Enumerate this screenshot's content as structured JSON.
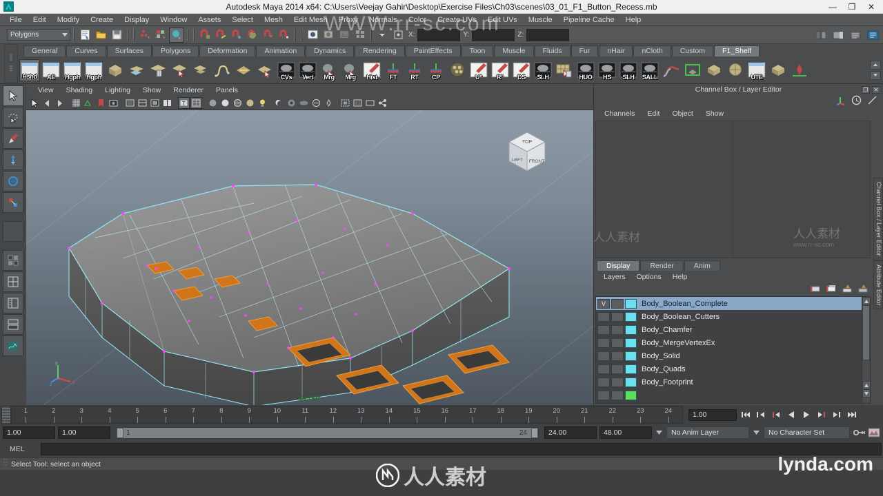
{
  "window": {
    "title": "Autodesk Maya 2014 x64: C:\\Users\\Veejay Gahir\\Desktop\\Exercise Files\\Ch03\\scenes\\03_01_F1_Button_Recess.mb",
    "minimize": "—",
    "maximize": "❐",
    "close": "✕"
  },
  "menubar": {
    "items": [
      "File",
      "Edit",
      "Modify",
      "Create",
      "Display",
      "Window",
      "Assets",
      "Select",
      "Mesh",
      "Edit Mesh",
      "Proxy",
      "Normals",
      "Color",
      "Create UVs",
      "Edit UVs",
      "Muscle",
      "Pipeline Cache",
      "Help"
    ]
  },
  "statusline": {
    "mode_selected": "Polygons",
    "x_label": "X:",
    "y_label": "Y:",
    "z_label": "Z:",
    "x_value": "",
    "y_value": "",
    "z_value": ""
  },
  "shelf": {
    "tabs": [
      "General",
      "Curves",
      "Surfaces",
      "Polygons",
      "Deformation",
      "Animation",
      "Dynamics",
      "Rendering",
      "PaintEffects",
      "Toon",
      "Muscle",
      "Fluids",
      "Fur",
      "nHair",
      "nCloth",
      "Custom",
      "F1_Shelf"
    ],
    "active_tab": "F1_Shelf",
    "buttons": [
      {
        "label": "Hshd",
        "type": "window",
        "selected": true
      },
      {
        "label": "AE",
        "type": "window",
        "selected": false
      },
      {
        "label": "Hgph",
        "type": "window",
        "selected": false
      },
      {
        "label": "Hgph",
        "type": "window",
        "selected": false
      },
      {
        "label": "",
        "type": "mesh-cube",
        "selected": false
      },
      {
        "label": "",
        "type": "mesh-plane",
        "selected": false
      },
      {
        "label": "",
        "type": "mesh-delete",
        "selected": false
      },
      {
        "label": "",
        "type": "mesh-select",
        "selected": false
      },
      {
        "label": "",
        "type": "mesh-combine",
        "selected": false
      },
      {
        "label": "",
        "type": "curve-s",
        "selected": false
      },
      {
        "label": "",
        "type": "bevel",
        "selected": false
      },
      {
        "label": "",
        "type": "extrude",
        "selected": false
      },
      {
        "label": "CVs",
        "type": "display",
        "selected": false
      },
      {
        "label": "Vert",
        "type": "display",
        "selected": false
      },
      {
        "label": "Mrg",
        "type": "merge",
        "selected": false
      },
      {
        "label": "Mrg",
        "type": "merge",
        "selected": false
      },
      {
        "label": "Hist",
        "type": "edit",
        "selected": false
      },
      {
        "label": "FT",
        "type": "xform",
        "selected": false
      },
      {
        "label": "RT",
        "type": "xform",
        "selected": false
      },
      {
        "label": "CP",
        "type": "xform",
        "selected": false
      },
      {
        "label": "",
        "type": "sphere-wire",
        "selected": false
      },
      {
        "label": "U\"",
        "type": "edit",
        "selected": false
      },
      {
        "label": "R\"",
        "type": "edit",
        "selected": false
      },
      {
        "label": "DS",
        "type": "edit",
        "selected": false
      },
      {
        "label": "SLH",
        "type": "display",
        "selected": false
      },
      {
        "label": "",
        "type": "grid-delete",
        "selected": false
      },
      {
        "label": "HUO",
        "type": "display",
        "selected": false
      },
      {
        "label": "HS",
        "type": "display",
        "selected": false
      },
      {
        "label": "SLH",
        "type": "display",
        "selected": false
      },
      {
        "label": "SALL",
        "type": "display",
        "selected": false
      },
      {
        "label": "",
        "type": "curve-red",
        "selected": false
      },
      {
        "label": "",
        "type": "plane-green",
        "selected": false
      },
      {
        "label": "",
        "type": "cube-tan",
        "selected": false
      },
      {
        "label": "",
        "type": "sphere-tan",
        "selected": false
      },
      {
        "label": "UTE",
        "type": "window",
        "selected": false
      },
      {
        "label": "",
        "type": "cube-tan",
        "selected": false
      },
      {
        "label": "",
        "type": "joint-red",
        "selected": false
      }
    ]
  },
  "toolbox": {
    "tools": [
      {
        "name": "select-tool",
        "active": true
      },
      {
        "name": "lasso-tool",
        "active": false
      },
      {
        "name": "paint-select-tool",
        "active": false
      },
      {
        "name": "move-tool",
        "active": false
      },
      {
        "name": "rotate-tool",
        "active": false
      },
      {
        "name": "scale-tool",
        "active": false
      },
      {
        "name": "blank-tool",
        "active": false
      },
      {
        "name": "layout-single",
        "active": false
      },
      {
        "name": "layout-four",
        "active": false
      },
      {
        "name": "layout-two-stacked",
        "active": false
      },
      {
        "name": "layout-persp-outliner",
        "active": false
      },
      {
        "name": "layout-hypershade",
        "active": false
      }
    ]
  },
  "viewport": {
    "menu": [
      "View",
      "Shading",
      "Lighting",
      "Show",
      "Renderer",
      "Panels"
    ],
    "camera_label": "persp",
    "viewcube": {
      "top": "TOP",
      "left": "LEFT",
      "front": "FRONT"
    },
    "axis": {
      "x": "x",
      "y": "y",
      "z": "z"
    }
  },
  "channelbox": {
    "panel_title": "Channel Box / Layer Editor",
    "menu": [
      "Channels",
      "Edit",
      "Object",
      "Show"
    ],
    "side_tabs": [
      "Channel Box / Layer Editor",
      "Attribute Editor"
    ]
  },
  "layereditor": {
    "tabs": [
      "Display",
      "Render",
      "Anim"
    ],
    "active_tab": "Display",
    "menu": [
      "Layers",
      "Options",
      "Help"
    ],
    "visibility_on": "V",
    "layers": [
      {
        "name": "Body_Boolean_Complete",
        "visible": true,
        "selected": true,
        "color": "#6de0f0"
      },
      {
        "name": "Body_Boolean_Cutters",
        "visible": false,
        "selected": false,
        "color": "#6de0f0"
      },
      {
        "name": "Body_Chamfer",
        "visible": false,
        "selected": false,
        "color": "#6de0f0"
      },
      {
        "name": "Body_MergeVertexEx",
        "visible": false,
        "selected": false,
        "color": "#6de0f0"
      },
      {
        "name": "Body_Solid",
        "visible": false,
        "selected": false,
        "color": "#6de0f0"
      },
      {
        "name": "Body_Quads",
        "visible": false,
        "selected": false,
        "color": "#6de0f0"
      },
      {
        "name": "Body_Footprint",
        "visible": false,
        "selected": false,
        "color": "#6de0f0"
      },
      {
        "name": "",
        "visible": false,
        "selected": false,
        "color": "#5ce05c"
      }
    ]
  },
  "timeslider": {
    "ticks": [
      1,
      2,
      3,
      4,
      5,
      6,
      7,
      8,
      9,
      10,
      11,
      12,
      13,
      14,
      15,
      16,
      17,
      18,
      19,
      20,
      21,
      22,
      23,
      24
    ],
    "current_frame": "1.00",
    "playback_buttons": [
      "go-to-start",
      "step-back-key",
      "step-back-frame",
      "play-backwards",
      "play-forwards",
      "step-forward-frame",
      "step-forward-key",
      "go-to-end"
    ]
  },
  "rangeslider": {
    "anim_start": "1.00",
    "range_start": "1.00",
    "range_track_start": "1",
    "range_track_end": "24",
    "range_end": "24.00",
    "anim_end": "48.00",
    "anim_layer": "No Anim Layer",
    "character_set": "No Character Set"
  },
  "commandline": {
    "language": "MEL",
    "value": "",
    "status": "Select Tool: select an object"
  },
  "watermarks": {
    "top": "WWW.rr-sc.com",
    "center_cn": "人人素材",
    "brand": "lynda.com",
    "cn_small": "www.rr-sc.com"
  }
}
